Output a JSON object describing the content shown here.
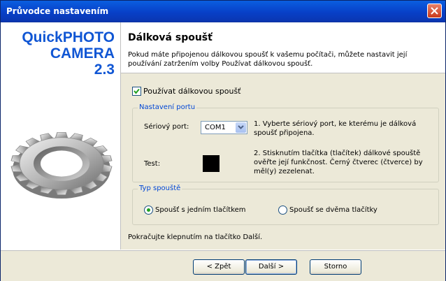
{
  "window": {
    "title": "Průvodce nastavením"
  },
  "brand": {
    "line1": "QuickPHOTO",
    "line2": "CAMERA",
    "line3": "2.3"
  },
  "header": {
    "title": "Dálková spoušť",
    "description": "Pokud máte připojenou dálkovou spoušť k vašemu počítači, můžete nastavit její používání zatržením volby Používat dálkovou spoušť."
  },
  "use_remote": {
    "label": "Používat dálkovou spoušť",
    "checked": true
  },
  "port_settings": {
    "group_title": "Nastavení portu",
    "serial_port_label": "Sériový port:",
    "serial_port_value": "COM1",
    "hint1": "1. Vyberte sériový port, ke kterému je dálková spoušť připojena.",
    "test_label": "Test:",
    "test_indicator_color": "#000000",
    "hint2": "2. Stisknutím tlačítka (tlačítek) dálkové spouště ověřte její funkčnost. Černý čtverec (čtverce) by měl(y) zezelenat."
  },
  "trigger_type": {
    "group_title": "Typ spouště",
    "option1": "Spoušť s jedním tlačítkem",
    "option2": "Spoušť se dvěma tlačítky",
    "selected": "option1"
  },
  "footer_text": "Pokračujte klepnutím na tlačítko Další.",
  "buttons": {
    "back": "< Zpět",
    "next": "Další >",
    "cancel": "Storno"
  },
  "colors": {
    "brand": "#1056d4",
    "group_title": "#0046d5",
    "titlebar": "#0840c8"
  }
}
